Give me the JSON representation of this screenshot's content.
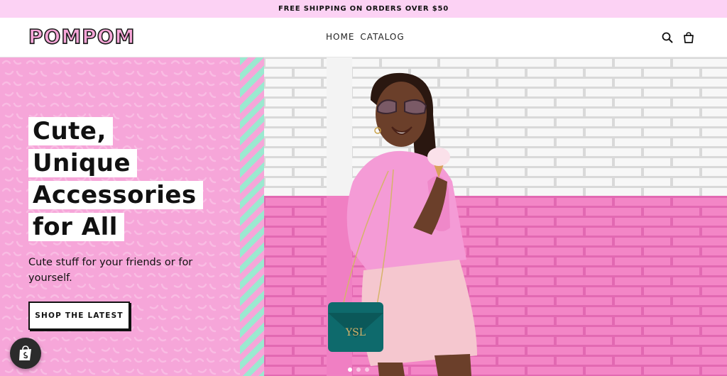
{
  "announcement": {
    "text": "FREE SHIPPING ON ORDERS OVER $50"
  },
  "header": {
    "logo": "POMPOM",
    "nav": [
      {
        "label": "HOME"
      },
      {
        "label": "CATALOG"
      }
    ],
    "icons": {
      "search": "search-icon",
      "cart": "shopping-bag-icon"
    }
  },
  "hero": {
    "headline_lines": [
      "Cute,",
      "Unique",
      "Accessories",
      "for All"
    ],
    "subtext": "Cute stuff for your friends or for yourself.",
    "cta_label": "SHOP THE LATEST",
    "slides": {
      "count": 3,
      "active": 1
    },
    "colors": {
      "panel": "#f6a6d9",
      "stripe_mint": "#9be9d0",
      "brick_pink": "#f07fc3",
      "brick_white": "#f5f5f5"
    }
  },
  "badge": {
    "icon": "shopify-bag-icon"
  }
}
